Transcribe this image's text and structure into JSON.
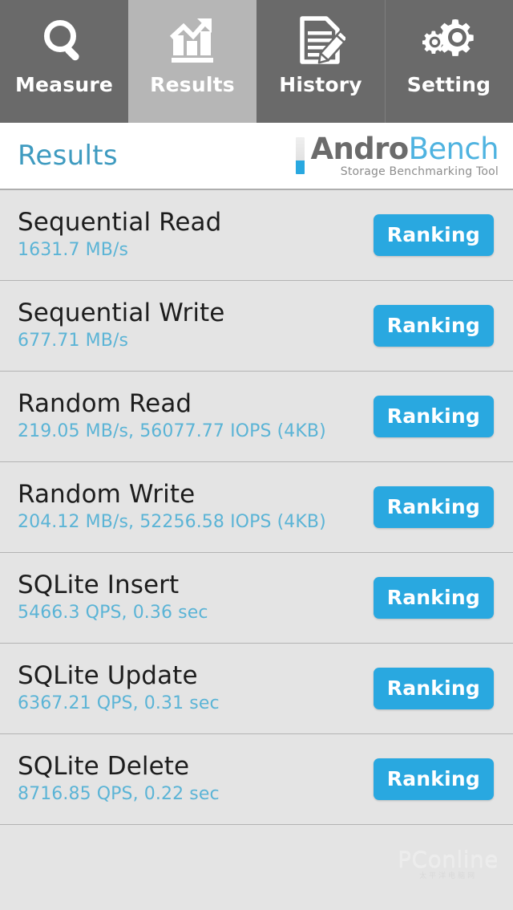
{
  "tabs": [
    {
      "label": "Measure",
      "icon": "magnifier-icon",
      "active": false
    },
    {
      "label": "Results",
      "icon": "bar-chart-trend-icon",
      "active": true
    },
    {
      "label": "History",
      "icon": "document-pencil-icon",
      "active": false
    },
    {
      "label": "Setting",
      "icon": "gears-icon",
      "active": false
    }
  ],
  "header": {
    "title": "Results",
    "brand_primary": "Andro",
    "brand_secondary": "Bench",
    "brand_tagline": "Storage Benchmarking Tool"
  },
  "colors": {
    "tab_bar": "#6a6a6a",
    "tab_active": "#b6b6b6",
    "accent_blue": "#29a8e0",
    "value_blue": "#5bb4d6",
    "title_blue": "#3f9bc0",
    "row_background": "#e4e4e4",
    "row_divider": "#b3b3b3"
  },
  "results": [
    {
      "name": "Sequential Read",
      "value": "1631.7 MB/s",
      "action": "Ranking"
    },
    {
      "name": "Sequential Write",
      "value": "677.71 MB/s",
      "action": "Ranking"
    },
    {
      "name": "Random Read",
      "value": "219.05 MB/s, 56077.77 IOPS (4KB)",
      "action": "Ranking"
    },
    {
      "name": "Random Write",
      "value": "204.12 MB/s, 52256.58 IOPS (4KB)",
      "action": "Ranking"
    },
    {
      "name": "SQLite Insert",
      "value": "5466.3 QPS, 0.36 sec",
      "action": "Ranking"
    },
    {
      "name": "SQLite Update",
      "value": "6367.21 QPS, 0.31 sec",
      "action": "Ranking"
    },
    {
      "name": "SQLite Delete",
      "value": "8716.85 QPS, 0.22 sec",
      "action": "Ranking"
    }
  ],
  "watermark": {
    "main": "PConline",
    "sub": "太平洋电脑网"
  }
}
